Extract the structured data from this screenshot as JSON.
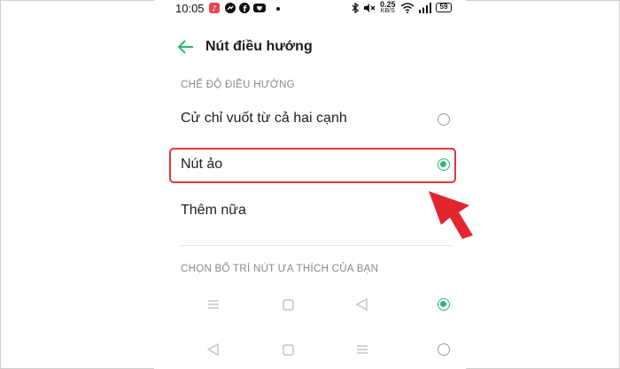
{
  "status_bar": {
    "time": "10:05",
    "net_speed_value": "0.25",
    "net_speed_unit": "KB/S",
    "battery": "59"
  },
  "header": {
    "title": "Nút điều hướng"
  },
  "navigation_mode": {
    "section_title": "CHẾ ĐỘ ĐIỀU HƯỚNG",
    "options": [
      {
        "label": "Cử chỉ vuốt từ cả hai cạnh",
        "selected": false
      },
      {
        "label": "Nút ảo",
        "selected": true
      }
    ],
    "more_label": "Thêm nữa"
  },
  "layout_preference": {
    "section_title": "CHỌN BỐ TRÍ NÚT ƯA THÍCH CỦA BẠN",
    "layouts": [
      {
        "buttons": [
          "menu-icon",
          "square-icon",
          "triangle-left-icon"
        ],
        "selected": true
      },
      {
        "buttons": [
          "triangle-left-icon",
          "square-icon",
          "menu-icon"
        ],
        "selected": false
      }
    ]
  },
  "colors": {
    "accent": "#2eb872",
    "highlight_box": "#e0383d",
    "pointer_arrow": "#e3262d"
  }
}
